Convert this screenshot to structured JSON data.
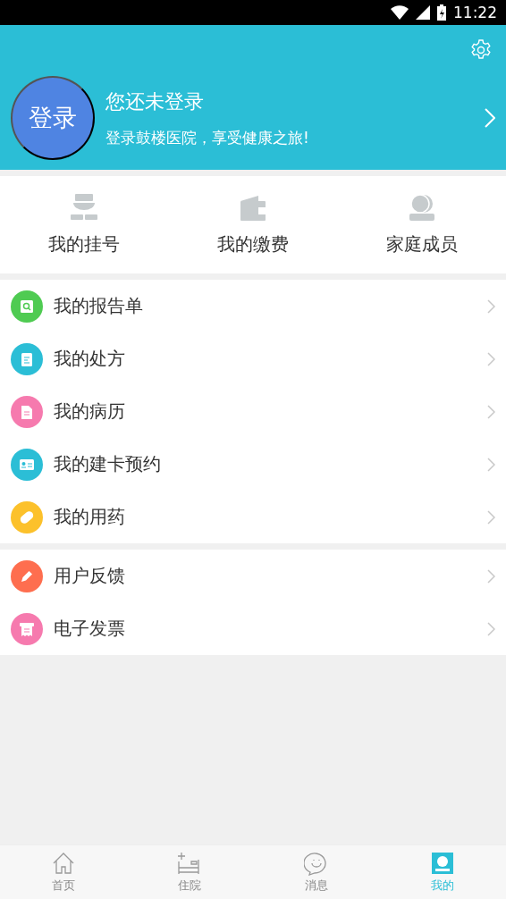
{
  "status_bar": {
    "time": "11:22"
  },
  "profile": {
    "avatar_label": "登录",
    "title": "您还未登录",
    "subtitle": "登录鼓楼医院，享受健康之旅!"
  },
  "quick_actions": [
    {
      "kind": "doctor",
      "label": "我的挂号"
    },
    {
      "kind": "wallet",
      "label": "我的缴费"
    },
    {
      "kind": "family",
      "label": "家庭成员"
    }
  ],
  "menu_groups": [
    [
      {
        "kind": "search",
        "label": "我的报告单",
        "color": "#4fcb52"
      },
      {
        "kind": "clipboard",
        "label": "我的处方",
        "color": "#2bbed6"
      },
      {
        "kind": "document",
        "label": "我的病历",
        "color": "#f67aae"
      },
      {
        "kind": "card",
        "label": "我的建卡预约",
        "color": "#2bbed6"
      },
      {
        "kind": "pill",
        "label": "我的用药",
        "color": "#fcc12b"
      }
    ],
    [
      {
        "kind": "pencil",
        "label": "用户反馈",
        "color": "#fe6e4f"
      },
      {
        "kind": "invoice",
        "label": "电子发票",
        "color": "#f67aae"
      }
    ]
  ],
  "tabs": [
    {
      "kind": "home",
      "label": "首页",
      "selected": false
    },
    {
      "kind": "bed",
      "label": "住院",
      "selected": false
    },
    {
      "kind": "chat",
      "label": "消息",
      "selected": false
    },
    {
      "kind": "profile",
      "label": "我的",
      "selected": true
    }
  ]
}
